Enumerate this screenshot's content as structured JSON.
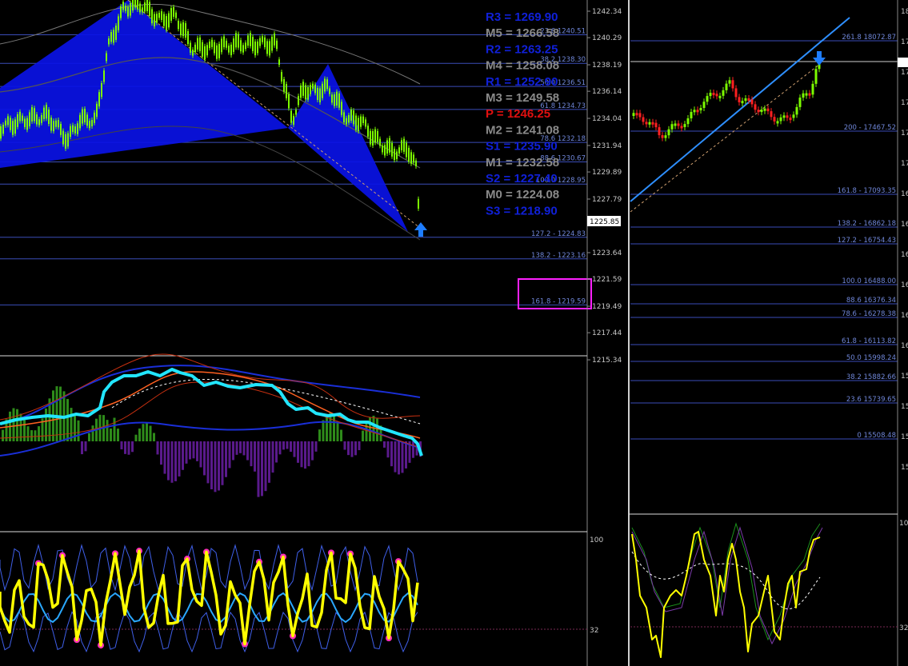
{
  "colors": {
    "background": "#000000",
    "pivot_blue": "#1020d8",
    "pivot_gray": "#8a8a8a",
    "pivot_red": "#e01010",
    "fib_line": "#3a4db8",
    "harmonic_fill": "#0a12e6",
    "candle_green": "#7cfc00",
    "candle_red": "#ff2020",
    "trendline": "#2e8fff",
    "rsi_yellow": "#ffff00",
    "rsi_magenta": "#ff2fb8",
    "macd_cyan": "#22e6ff",
    "hist_green": "#2e8b1a",
    "hist_purple": "#5a1a8c",
    "highlight_box": "#ff20ff"
  },
  "left_chart": {
    "pivots": [
      {
        "label": "R3 = 1269.90",
        "color": "blue",
        "price": 1269.9
      },
      {
        "label": "M5 = 1266.58",
        "color": "gray",
        "price": 1266.58
      },
      {
        "label": "R2 = 1263.25",
        "color": "blue",
        "price": 1263.25
      },
      {
        "label": "M4 = 1258.08",
        "color": "gray",
        "price": 1258.08
      },
      {
        "label": "R1 = 1252.90",
        "color": "blue",
        "price": 1252.9
      },
      {
        "label": "M3 = 1249.58",
        "color": "gray",
        "price": 1249.58
      },
      {
        "label": "P   = 1246.25",
        "color": "red",
        "price": 1246.25
      },
      {
        "label": "M2 = 1241.08",
        "color": "gray",
        "price": 1241.08
      },
      {
        "label": "S1 = 1235.90",
        "color": "blue",
        "price": 1235.9
      },
      {
        "label": "M1 = 1232.58",
        "color": "gray",
        "price": 1232.58
      },
      {
        "label": "S2 = 1227.40",
        "color": "blue",
        "price": 1227.4
      },
      {
        "label": "M0 = 1224.08",
        "color": "gray",
        "price": 1224.08
      },
      {
        "label": "S3 = 1218.90",
        "color": "blue",
        "price": 1218.9
      }
    ],
    "fib_levels": [
      {
        "label": "23.6 1240.51",
        "price": 1240.51
      },
      {
        "label": "38.2 1238.30",
        "price": 1238.3
      },
      {
        "label": "50.0 1236.51",
        "price": 1236.51
      },
      {
        "label": "61.8 1234.73",
        "price": 1234.73
      },
      {
        "label": "78.6 1232.18",
        "price": 1232.18
      },
      {
        "label": "88.6 1230.67",
        "price": 1230.67
      },
      {
        "label": "100.0 1228.95",
        "price": 1228.95
      },
      {
        "label": "127.2 - 1224.83",
        "price": 1224.83
      },
      {
        "label": "138.2 - 1223.16",
        "price": 1223.16
      },
      {
        "label": "161.8 -  1219.59",
        "price": 1219.59
      }
    ],
    "price_axis": [
      "1242.34",
      "1240.29",
      "1238.19",
      "1236.14",
      "1234.04",
      "1231.94",
      "1229.89",
      "1227.79",
      "1225.85",
      "1223.64",
      "1221.59",
      "1219.49",
      "1217.44",
      "1215.34"
    ],
    "current_price": "1225.85",
    "highlighted_label": "161.8 -  1219.59"
  },
  "left_oscillator": {
    "axis_labels": [
      "100",
      "32"
    ]
  },
  "right_chart": {
    "fib_levels": [
      {
        "label": "261.8 18072.87"
      },
      {
        "label": "200 - 17467.52"
      },
      {
        "label": "161.8 -  17093.35"
      },
      {
        "label": "138.2 - 16862.18"
      },
      {
        "label": "127.2 - 16754.43"
      },
      {
        "label": "100.0 16488.00"
      },
      {
        "label": "88.6 16376.34"
      },
      {
        "label": "78.6 - 16278.38"
      },
      {
        "label": "61.8 - 16113.82"
      },
      {
        "label": "50.0 15998.24"
      },
      {
        "label": "38.2 15882.66"
      },
      {
        "label": "23.6 15739.65"
      },
      {
        "label": "0 15508.48"
      }
    ],
    "axis_partial": [
      "18",
      "17",
      "17",
      "17",
      "17",
      "17",
      "16",
      "16",
      "16",
      "16",
      "16",
      "16",
      "15",
      "15",
      "15",
      "15"
    ]
  },
  "right_oscillator": {
    "axis_labels": [
      "10",
      "32"
    ]
  }
}
